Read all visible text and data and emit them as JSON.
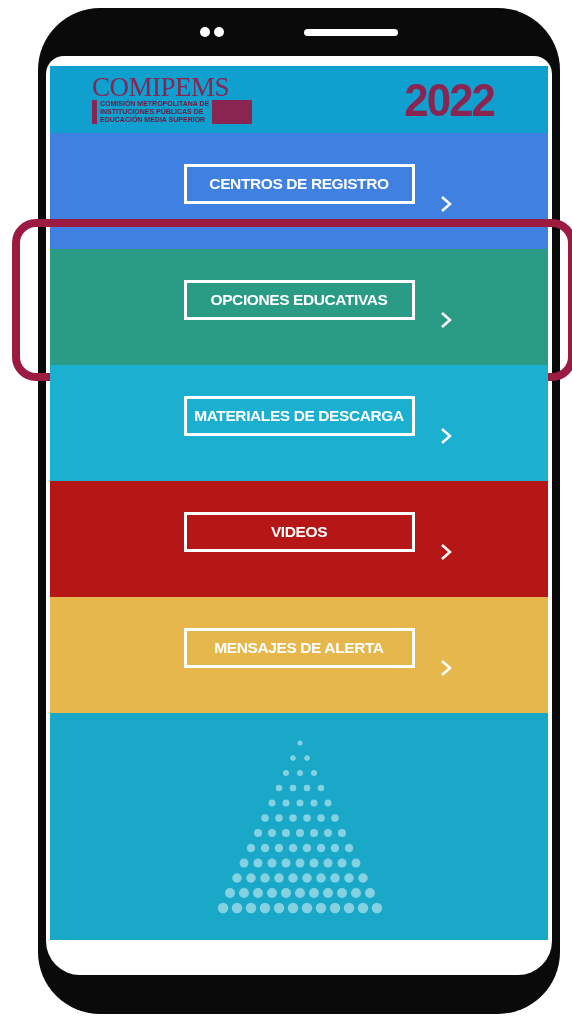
{
  "header": {
    "logo_text": "COMIPEMS",
    "logo_subtitle_lines": [
      "COMISIÓN METROPOLITANA DE",
      "INSTITUCIONES PÚBLICAS DE",
      "EDUCACIÓN MEDIA SUPERIOR"
    ],
    "year": "2022"
  },
  "menu": [
    {
      "label": "CENTROS DE REGISTRO",
      "color": "#3f80e0",
      "selected": false
    },
    {
      "label": "OPCIONES EDUCATIVAS",
      "color": "#2a9c86",
      "selected": true
    },
    {
      "label": "MATERIALES DE DESCARGA",
      "color": "#1bafd0",
      "selected": false
    },
    {
      "label": "VIDEOS",
      "color": "#b51616",
      "selected": false
    },
    {
      "label": "MENSAJES DE ALERTA",
      "color": "#e6b84c",
      "selected": false
    }
  ]
}
